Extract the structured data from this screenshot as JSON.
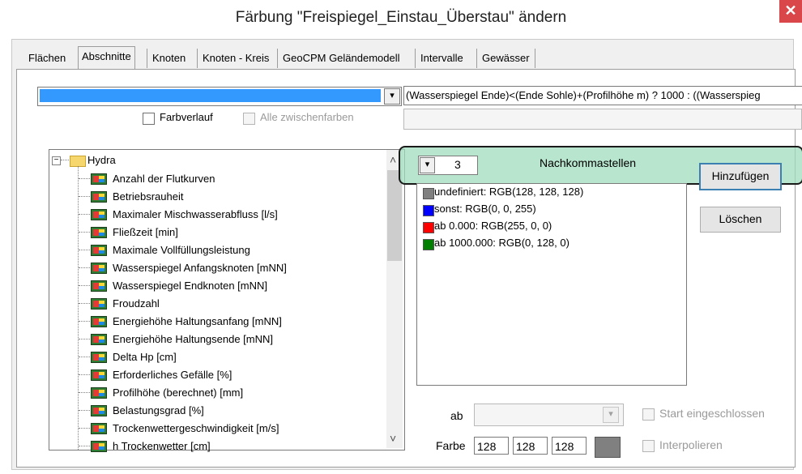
{
  "window": {
    "title": "Färbung \"Freispiegel_Einstau_Überstau\" ändern",
    "close_glyph": "✕"
  },
  "tabs": [
    {
      "label": "Flächen"
    },
    {
      "label": "Abschnitte",
      "active": true
    },
    {
      "label": "Knoten"
    },
    {
      "label": "Knoten - Kreis"
    },
    {
      "label": "GeoCPM Geländemodell"
    },
    {
      "label": "Intervalle"
    },
    {
      "label": "Gewässer"
    }
  ],
  "expression": "(Wasserspiegel Ende)<(Ende Sohle)+(Profilhöhe m) ? 1000 : ((Wasserspieg",
  "options": {
    "farbverlauf": {
      "label": "Farbverlauf",
      "checked": false
    },
    "alle_zwischenfarben": {
      "label": "Alle zwischenfarben",
      "checked": false,
      "disabled": true
    }
  },
  "tree": {
    "root": "Hydra",
    "items": [
      "Anzahl der Flutkurven",
      "Betriebsrauheit",
      "Maximaler Mischwasserabfluss [l/s]",
      "Fließzeit [min]",
      "Maximale Vollfüllungsleistung",
      "Wasserspiegel Anfangsknoten [mNN]",
      "Wasserspiegel Endknoten [mNN]",
      "Froudzahl",
      "Energiehöhe Haltungsanfang [mNN]",
      "Energiehöhe Haltungsende [mNN]",
      "Delta Hp [cm]",
      "Erforderliches Gefälle [%]",
      "Profilhöhe (berechnet) [mm]",
      "Belastungsgrad [%]",
      "Trockenwettergeschwindigkeit [m/s]",
      "h Trockenwetter [cm]"
    ]
  },
  "decimals": {
    "value": "3",
    "label": "Nachkommastellen"
  },
  "colors": {
    "items": [
      {
        "text": "undefiniert: RGB(128, 128, 128)",
        "color": "#808080"
      },
      {
        "text": "sonst: RGB(0, 0, 255)",
        "color": "#0000ff"
      },
      {
        "text": "ab 0.000: RGB(255, 0, 0)",
        "color": "#ff0000"
      },
      {
        "text": "ab 1000.000: RGB(0, 128, 0)",
        "color": "#008000"
      }
    ],
    "add_label": "Hinzufügen",
    "delete_label": "Löschen"
  },
  "ab": {
    "label": "ab",
    "value": ""
  },
  "start_eingeschlossen": {
    "label": "Start eingeschlossen",
    "checked": false,
    "disabled": true
  },
  "farbe": {
    "label": "Farbe",
    "r": "128",
    "g": "128",
    "b": "128",
    "swatch": "#808080"
  },
  "interpolieren": {
    "label": "Interpolieren",
    "checked": false,
    "disabled": true
  },
  "glyphs": {
    "dropdown": "▾",
    "scroll_up": "˄",
    "scroll_down": "˅",
    "tree_minus": "−"
  }
}
